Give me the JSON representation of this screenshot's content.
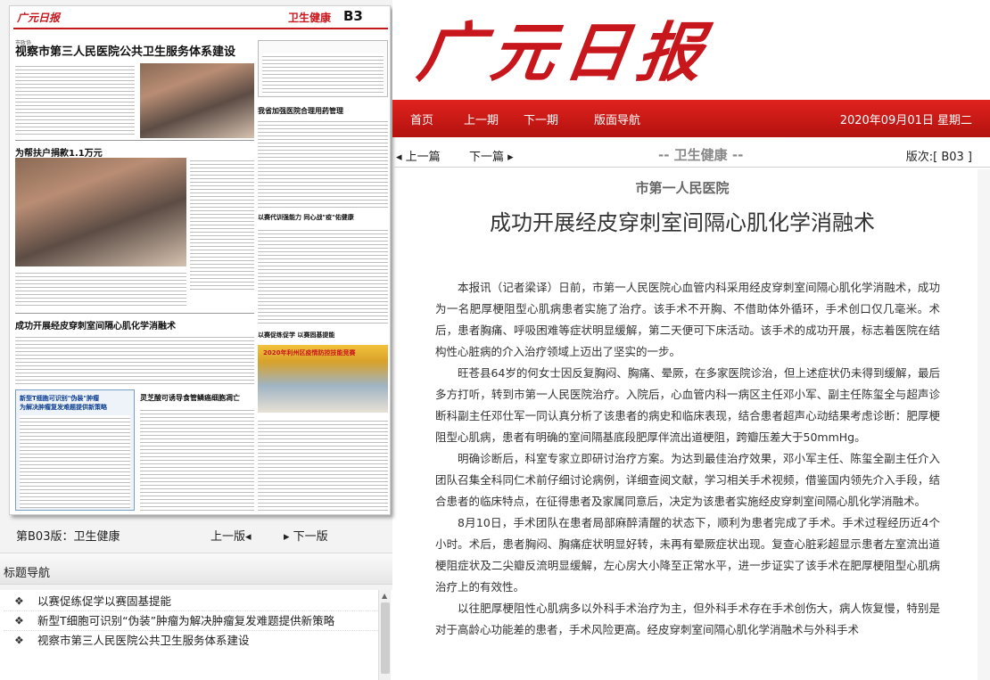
{
  "thumbnail": {
    "masthead": "广元日报",
    "section": "卫生健康",
    "page": "B3",
    "kicker": "市政协",
    "headline": "视察市第三人民医院公共卫生服务体系建设",
    "sub1": "为帮扶户捐款1.1万元",
    "sub2": "成功开展经皮穿刺室间隔心肌化学消融术",
    "sub3": "新型T细胞可识别\"伪装\"肿瘤",
    "sub3b": "为解决肿瘤复发难题提供新策略",
    "sub4": "灵芝酸可诱导食管鳞癌细胞凋亡",
    "sub5": "我省加强医院合理用药管理",
    "sub6": "以赛代训强能力 同心战\"疫\"佑健康",
    "sub7": "以赛促练促学 以赛固基提能",
    "banner": "2020年利州区疫情防控技能竞赛"
  },
  "page_nav": {
    "page_label": "第B03版：卫生健康",
    "prev_page": "上一版◂",
    "next_page": "▸ 下一版"
  },
  "toc": {
    "title": "标题导航",
    "items": [
      "以赛促练促学以赛固基提能",
      "新型T细胞可识别“伪装”肿瘤为解决肿瘤复发难题提供新策略",
      "视察市第三人民医院公共卫生服务体系建设"
    ]
  },
  "header": {
    "logo": "广元日报"
  },
  "topnav": {
    "home": "首页",
    "prev_issue": "上一期",
    "next_issue": "下一期",
    "layout_nav": "版面导航",
    "date": "2020年09月01日 星期二"
  },
  "article_nav": {
    "prev": "◂ 上一篇",
    "next": "下一篇 ▸",
    "section": "-- 卫生健康 --",
    "edition": "版次:[ B03 ]"
  },
  "article": {
    "subtitle": "市第一人民医院",
    "headline": "成功开展经皮穿刺室间隔心肌化学消融术",
    "paragraphs": [
      "本报讯（记者梁译）日前，市第一人民医院心血管内科采用经皮穿刺室间隔心肌化学消融术，成功为一名肥厚梗阻型心肌病患者实施了治疗。该手术不开胸、不借助体外循环，手术创口仅几毫米。术后，患者胸痛、呼吸困难等症状明显缓解，第二天便可下床活动。该手术的成功开展，标志着医院在结构性心脏病的介入治疗领域上迈出了坚实的一步。",
      "旺苍县64岁的何女士因反复胸闷、胸痛、晕厥，在多家医院诊治，但上述症状仍未得到缓解，最后多方打听，转到市第一人民医院治疗。入院后，心血管内科一病区主任邓小军、副主任陈玺全与超声诊断科副主任邓仕军一同认真分析了该患者的病史和临床表现，结合患者超声心动结果考虑诊断：肥厚梗阻型心肌病，患者有明确的室间隔基底段肥厚伴流出道梗阻，跨瓣压差大于50mmHg。",
      "明确诊断后，科室专家立即研讨治疗方案。为达到最佳治疗效果，邓小军主任、陈玺全副主任介入团队召集全科同仁术前仔细讨论病例，详细查阅文献，学习相关手术视频，借鉴国内领先介入手段，结合患者的临床特点，在征得患者及家属同意后，决定为该患者实施经皮穿刺室间隔心肌化学消融术。",
      "8月10日，手术团队在患者局部麻醉清醒的状态下，顺利为患者完成了手术。手术过程经历近4个小时。术后，患者胸闷、胸痛症状明显好转，未再有晕厥症状出现。复查心脏彩超显示患者左室流出道梗阻症状及二尖瓣反流明显缓解，左心房大小降至正常水平，进一步证实了该手术在肥厚梗阻型心肌病治疗上的有效性。",
      "以往肥厚梗阻性心肌病多以外科手术治疗为主，但外科手术存在手术创伤大，病人恢复慢，特别是对于高龄心功能差的患者，手术风险更高。经皮穿刺室间隔心肌化学消融术与外科手术"
    ]
  }
}
